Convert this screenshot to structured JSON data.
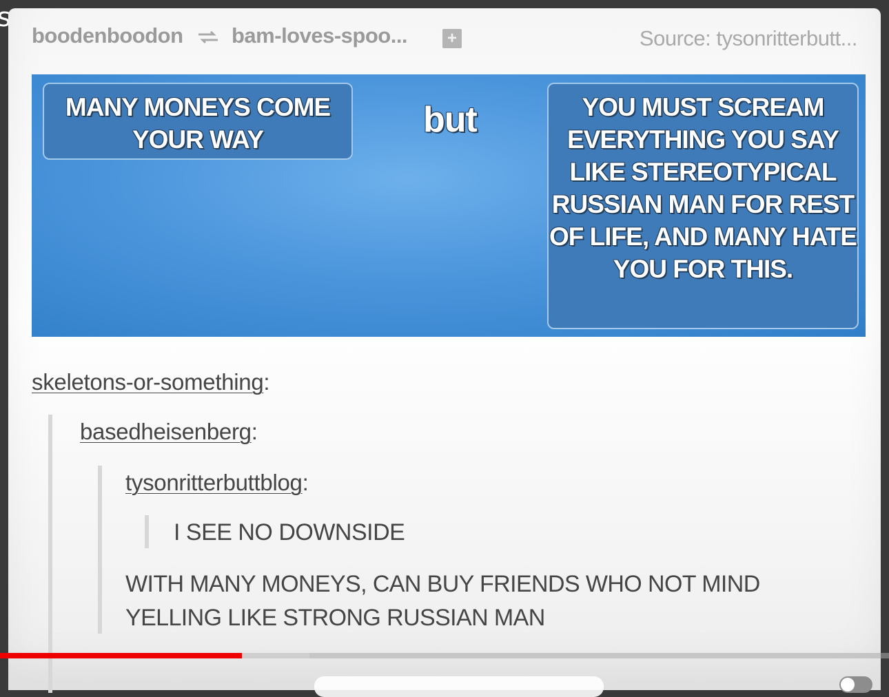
{
  "edge_text": "s",
  "header": {
    "username": "boodenboodon",
    "reblog_icon": "reblog-icon",
    "reblogged_from": "bam-loves-spoo...",
    "follow_icon": "plus-icon",
    "source": "Source: tysonritterbutt..."
  },
  "meme": {
    "left_text": "MANY MONEYS COME YOUR WAY",
    "middle_text": "but",
    "right_text": "YOU MUST SCREAM EVERYTHING YOU SAY LIKE STEREOTYPICAL RUSSIAN MAN FOR REST OF LIFE, AND MANY HATE YOU FOR THIS.",
    "colors": {
      "box": "#3f7bb8",
      "background": "#4b95dc"
    }
  },
  "thread": {
    "colon": ":",
    "users": [
      "skeletons-or-something",
      "basedheisenberg",
      "tysonritterbuttblog"
    ],
    "quote": "I SEE NO DOWNSIDE",
    "reply": "WITH MANY MONEYS, CAN BUY FRIENDS WHO NOT MIND YELLING LIKE STRONG RUSSIAN MAN"
  },
  "player": {
    "progress_fraction": 0.272,
    "buffered_fraction": 0.348,
    "colors": {
      "progress": "#ee0000"
    }
  }
}
